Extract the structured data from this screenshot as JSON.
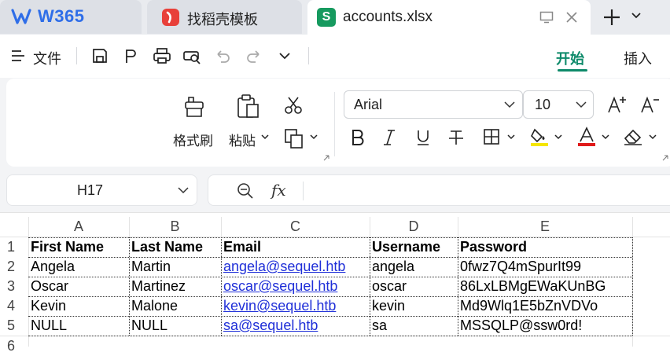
{
  "tabs": {
    "wps_logo": "W365",
    "docer": "找稻壳模板",
    "file": "accounts.xlsx"
  },
  "menu": {
    "file": "文件",
    "start": "开始",
    "insert": "插入"
  },
  "ribbon": {
    "format_painter": "格式刷",
    "paste": "粘贴",
    "font_name": "Arial",
    "font_size": "10"
  },
  "formula_bar": {
    "name_box": "H17",
    "fx": "fx",
    "value": ""
  },
  "sheet": {
    "columns": [
      "A",
      "B",
      "C",
      "D",
      "E"
    ],
    "rows": [
      "1",
      "2",
      "3",
      "4",
      "5",
      "6"
    ],
    "header": [
      "First Name",
      "Last Name",
      "Email",
      "Username",
      "Password"
    ],
    "data": [
      [
        "Angela",
        "Martin",
        "angela@sequel.htb",
        "angela",
        "0fwz7Q4mSpurIt99"
      ],
      [
        "Oscar",
        "Martinez",
        "oscar@sequel.htb",
        "oscar",
        "86LxLBMgEWaKUnBG"
      ],
      [
        "Kevin",
        "Malone",
        "kevin@sequel.htb",
        "kevin",
        "Md9Wlq1E5bZnVDVo"
      ],
      [
        "NULL",
        "NULL",
        "sa@sequel.htb",
        "sa",
        "MSSQLP@ssw0rd!"
      ]
    ]
  },
  "colors": {
    "accent": "#0e8a6a",
    "link": "#1f2fd8",
    "logo": "#2f6ee8"
  }
}
